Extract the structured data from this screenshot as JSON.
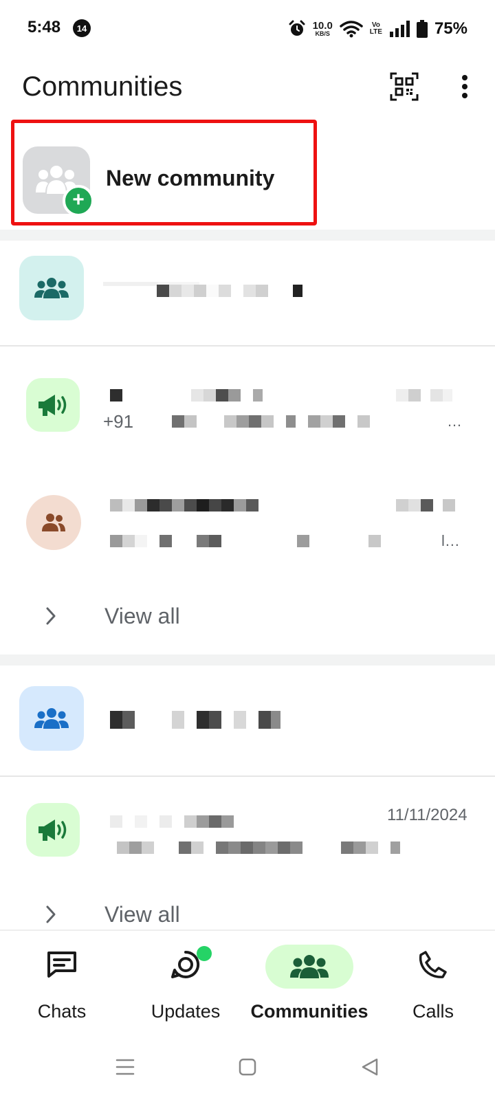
{
  "status_bar": {
    "time": "5:48",
    "notification_count": "14",
    "speed_value": "10.0",
    "speed_unit": "KB/S",
    "volte_top": "Vo",
    "volte_bottom": "LTE",
    "battery": "75%"
  },
  "header": {
    "title": "Communities"
  },
  "new_community": {
    "label": "New community"
  },
  "communities": [
    {
      "items": [
        {
          "subtitle_prefix": "+91"
        }
      ],
      "view_all": "View all"
    },
    {
      "items": [
        {
          "date": "11/11/2024"
        }
      ],
      "view_all": "View all"
    }
  ],
  "bottom_nav": {
    "items": [
      {
        "label": "Chats",
        "icon": "chat-icon"
      },
      {
        "label": "Updates",
        "icon": "updates-icon"
      },
      {
        "label": "Communities",
        "icon": "communities-icon",
        "active": true
      },
      {
        "label": "Calls",
        "icon": "phone-icon"
      }
    ]
  },
  "colors": {
    "accent_green": "#1fa855",
    "active_nav_bg": "#d8fdd2",
    "highlight_red": "#ee1111"
  }
}
